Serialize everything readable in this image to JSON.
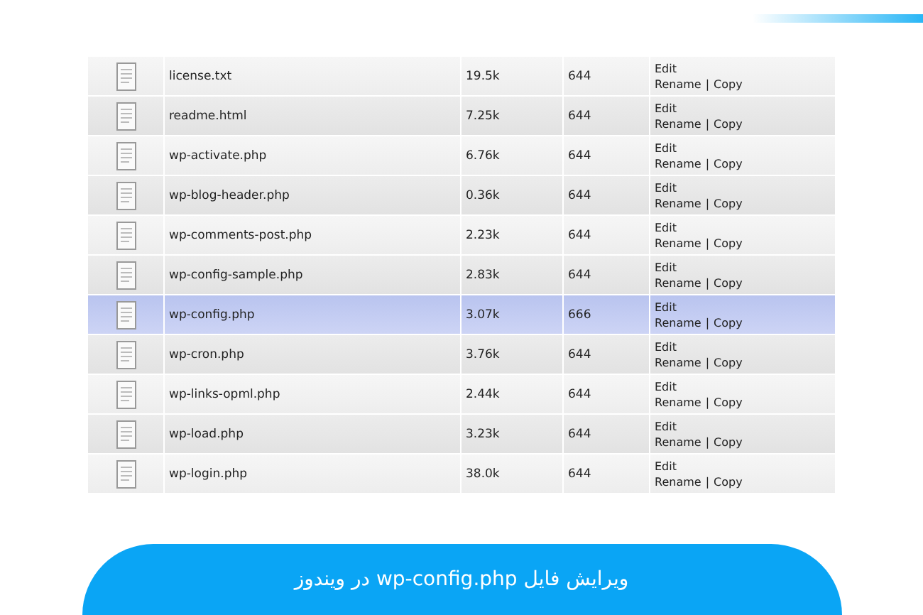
{
  "files": [
    {
      "name": "license.txt",
      "size": "19.5k",
      "perms": "644",
      "actions": [
        "Edit",
        "Rename",
        "Copy"
      ],
      "separator": "|",
      "selected": false
    },
    {
      "name": "readme.html",
      "size": "7.25k",
      "perms": "644",
      "actions": [
        "Edit",
        "Rename",
        "Copy"
      ],
      "separator": "|",
      "selected": false
    },
    {
      "name": "wp-activate.php",
      "size": "6.76k",
      "perms": "644",
      "actions": [
        "Edit",
        "Rename",
        "Copy"
      ],
      "separator": "|",
      "selected": false
    },
    {
      "name": "wp-blog-header.php",
      "size": "0.36k",
      "perms": "644",
      "actions": [
        "Edit",
        "Rename",
        "Copy"
      ],
      "separator": "|",
      "selected": false
    },
    {
      "name": "wp-comments-post.php",
      "size": "2.23k",
      "perms": "644",
      "actions": [
        "Edit",
        "Rename",
        "Copy"
      ],
      "separator": "|",
      "selected": false
    },
    {
      "name": "wp-config-sample.php",
      "size": "2.83k",
      "perms": "644",
      "actions": [
        "Edit",
        "Rename",
        "Copy"
      ],
      "separator": "|",
      "selected": false
    },
    {
      "name": "wp-config.php",
      "size": "3.07k",
      "perms": "666",
      "actions": [
        "Edit",
        "Rename",
        "Copy"
      ],
      "separator": "|",
      "selected": true
    },
    {
      "name": "wp-cron.php",
      "size": "3.76k",
      "perms": "644",
      "actions": [
        "Edit",
        "Rename",
        "Copy"
      ],
      "separator": "|",
      "selected": false
    },
    {
      "name": "wp-links-opml.php",
      "size": "2.44k",
      "perms": "644",
      "actions": [
        "Edit",
        "Rename",
        "Copy"
      ],
      "separator": "|",
      "selected": false
    },
    {
      "name": "wp-load.php",
      "size": "3.23k",
      "perms": "644",
      "actions": [
        "Edit",
        "Rename",
        "Copy"
      ],
      "separator": "|",
      "selected": false
    },
    {
      "name": "wp-login.php",
      "size": "38.0k",
      "perms": "644",
      "actions": [
        "Edit",
        "Rename",
        "Copy"
      ],
      "separator": "|",
      "selected": false
    }
  ],
  "caption": "ویرایش فایل wp-config.php در ویندوز"
}
